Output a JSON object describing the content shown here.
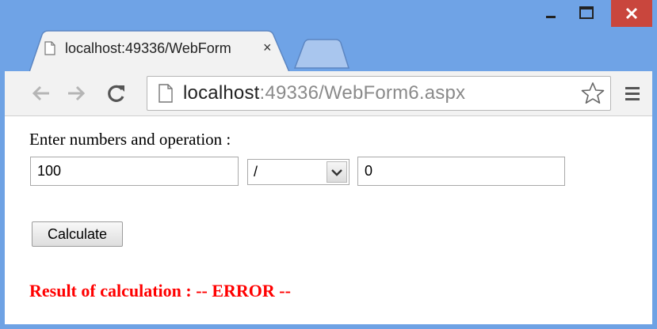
{
  "browser": {
    "tab_title": "localhost:49336/WebForm",
    "tab_close": "×",
    "url_host": "localhost",
    "url_rest": ":49336/WebForm6.aspx"
  },
  "form": {
    "prompt": "Enter numbers and operation :",
    "first_number": "100",
    "operation": "/",
    "second_number": "0",
    "calculate_label": "Calculate",
    "result": "Result of calculation : -- ERROR --"
  },
  "colors": {
    "frame": "#6ea2e4",
    "close_button": "#c9463d",
    "result_text": "#ff0000"
  },
  "icons": [
    "page-icon",
    "back-arrow-icon",
    "forward-arrow-icon",
    "reload-icon",
    "star-icon",
    "menu-icon",
    "minimize-icon",
    "maximize-icon",
    "close-icon",
    "chevron-down-icon"
  ]
}
